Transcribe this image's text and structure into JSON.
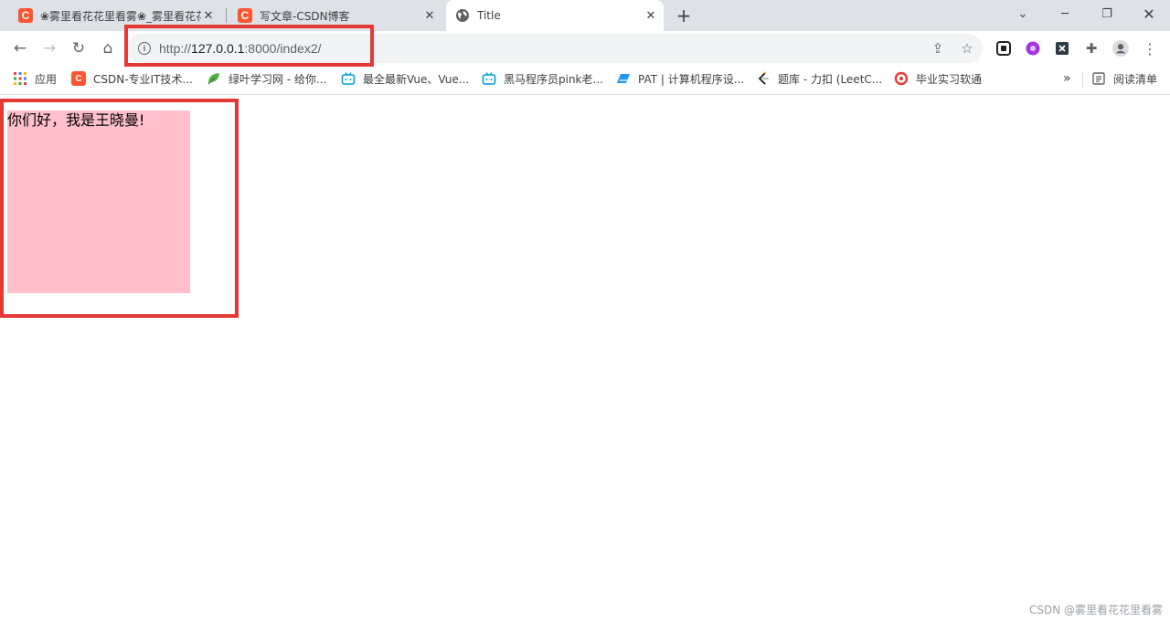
{
  "tabs": [
    {
      "title": "❀雾里看花花里看雾❀_雾里看花花里看雾",
      "active": false
    },
    {
      "title": "写文章-CSDN博客",
      "active": false
    },
    {
      "title": "Title",
      "active": true
    }
  ],
  "omnibox": {
    "scheme": "http://",
    "host": "127.0.0.1",
    "rest": ":8000/index2/"
  },
  "bookmarks": [
    {
      "label": "应用",
      "icon": "apps-grid-icon"
    },
    {
      "label": "CSDN-专业IT技术...",
      "icon": "csdn-icon"
    },
    {
      "label": "绿叶学习网 - 给你...",
      "icon": "leaf-icon"
    },
    {
      "label": "最全最新Vue、Vue...",
      "icon": "bilibili-icon"
    },
    {
      "label": "黑马程序员pink老...",
      "icon": "bilibili-icon"
    },
    {
      "label": "PAT | 计算机程序设...",
      "icon": "pat-icon"
    },
    {
      "label": "题库 - 力扣 (LeetC...",
      "icon": "leetcode-icon"
    },
    {
      "label": "毕业实习软通",
      "icon": "softtong-icon"
    }
  ],
  "bookmarks_overflow": "»",
  "reading_list": "阅读清单",
  "page": {
    "greeting": "你们好，我是王晓曼!"
  },
  "watermark": "CSDN @雾里看花花里看雾",
  "colors": {
    "pink_box": "#ffc0cb",
    "highlight": "#e53935",
    "csdn": "#fc5531"
  }
}
